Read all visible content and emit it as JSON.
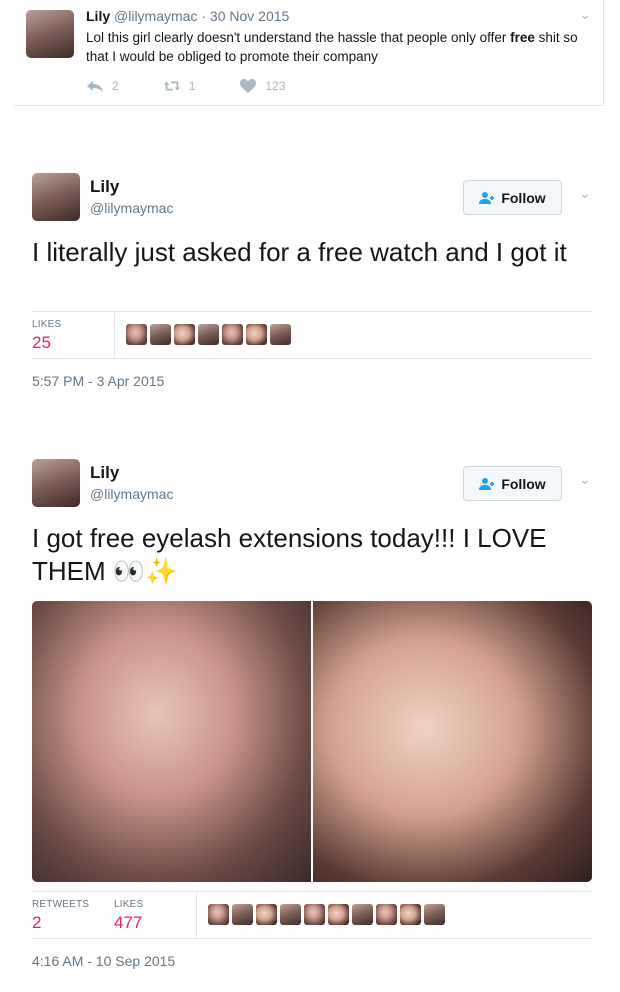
{
  "reply_tweet": {
    "name": "Lily",
    "handle": "@lilymaymac",
    "date": "30 Nov 2015",
    "text_before": "Lol this girl clearly doesn't understand the hassle that people only offer ",
    "text_bold": "free",
    "text_after": " shit so that I would be obliged to promote their company",
    "reply_count": "2",
    "retweet_count": "1",
    "like_count": "123"
  },
  "tweet1": {
    "name": "Lily",
    "handle": "@lilymaymac",
    "follow_label": "Follow",
    "text": "I literally just asked for a free watch and I got it",
    "likes_label": "LIKES",
    "likes": "25",
    "timestamp": "5:57 PM - 3 Apr 2015"
  },
  "tweet2": {
    "name": "Lily",
    "handle": "@lilymaymac",
    "follow_label": "Follow",
    "text": "I got free eyelash extensions today!!! I LOVE THEM 👀✨",
    "retweets_label": "RETWEETS",
    "retweets": "2",
    "likes_label": "LIKES",
    "likes": "477",
    "timestamp": "4:16 AM - 10 Sep 2015"
  },
  "colors": {
    "like_number": "#e0245e",
    "secondary_text": "#657786",
    "follow_icon": "#1da1f2"
  }
}
